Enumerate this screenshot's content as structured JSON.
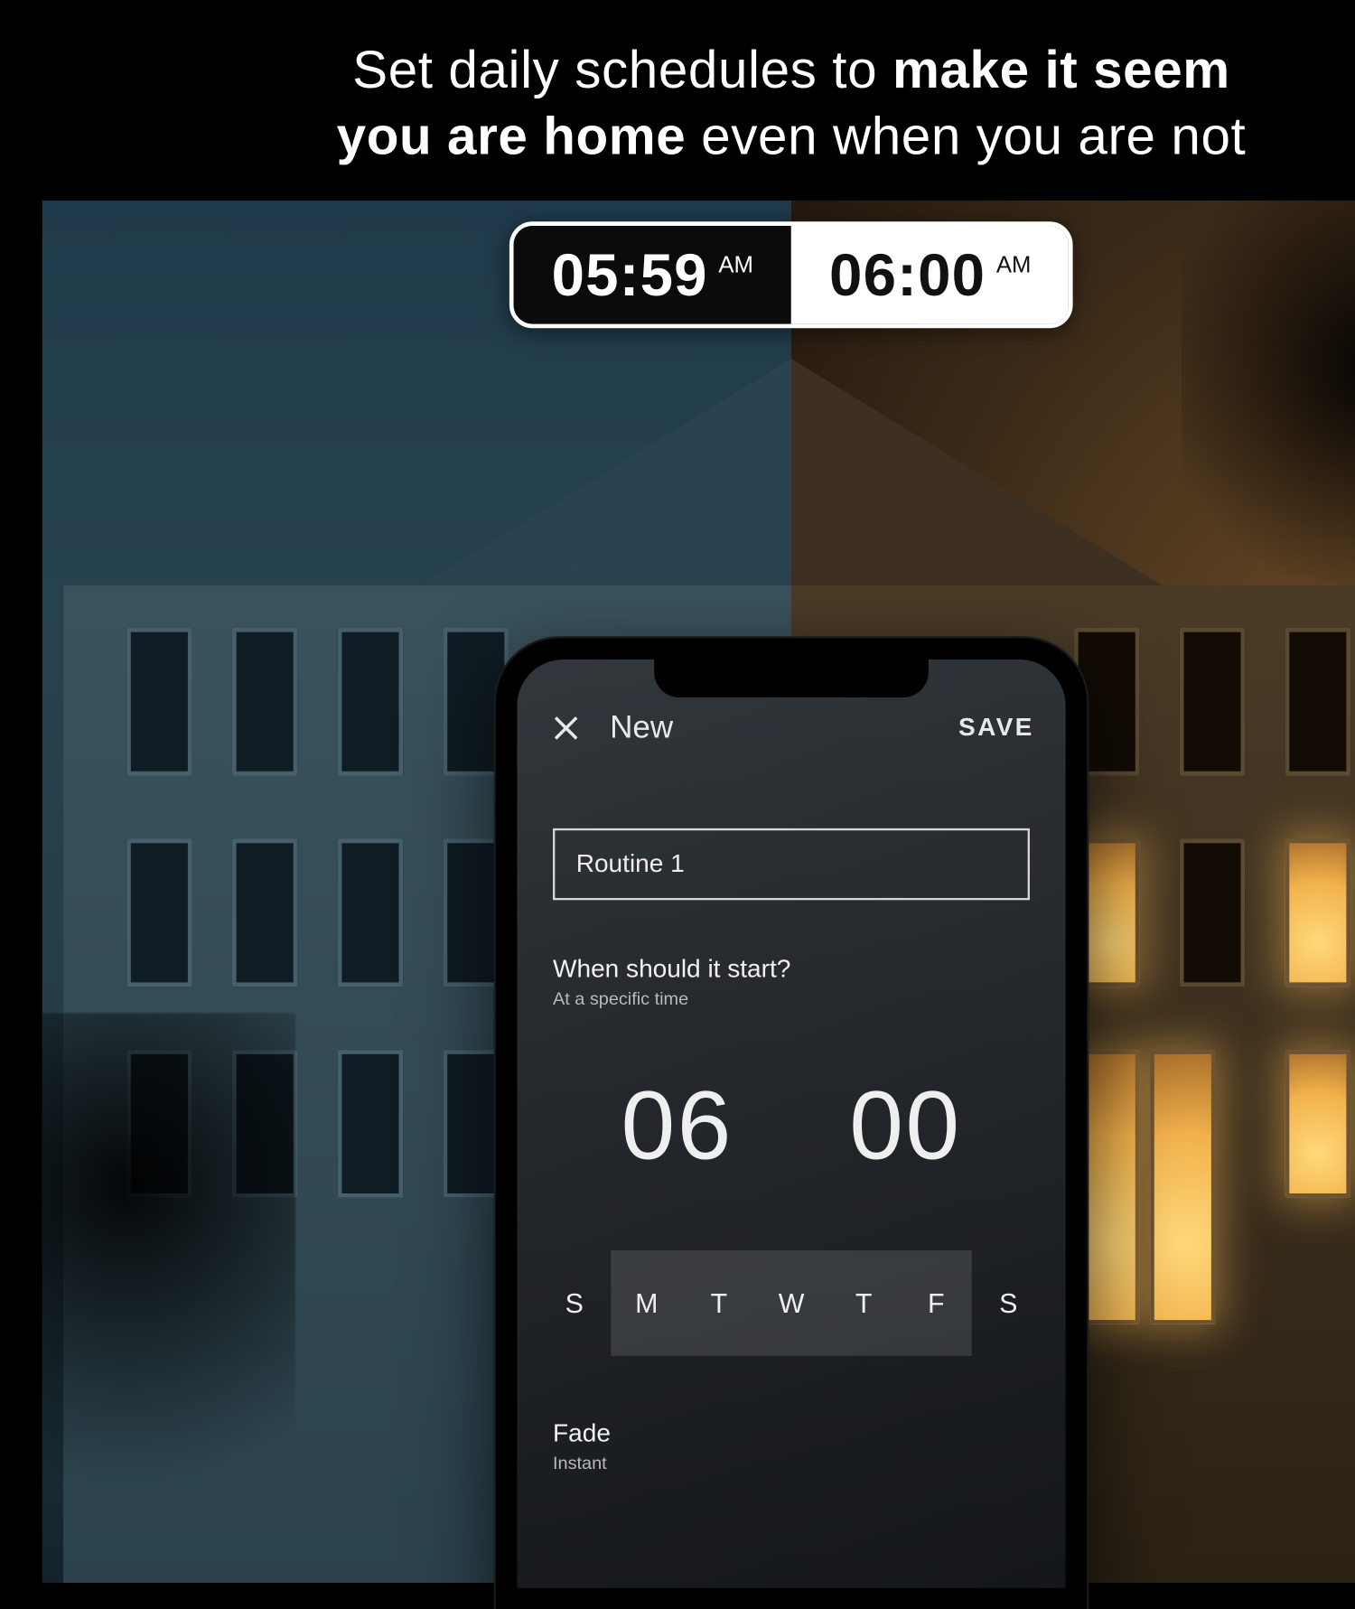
{
  "headline": {
    "pre": "Set daily schedules to ",
    "bold1": "make it seem",
    "br": true,
    "bold2": "you are home",
    "post": " even when you are not"
  },
  "timebadge": {
    "left_time": "05:59",
    "left_ampm": "AM",
    "right_time": "06:00",
    "right_ampm": "AM"
  },
  "app": {
    "title": "New",
    "save": "SAVE",
    "routine_name": "Routine 1",
    "question": "When should it start?",
    "question_sub": "At a specific time",
    "hour": "06",
    "minute": "00",
    "days": [
      "S",
      "M",
      "T",
      "W",
      "T",
      "F",
      "S"
    ],
    "days_selected": [
      false,
      true,
      true,
      true,
      true,
      true,
      false
    ],
    "fade_label": "Fade",
    "fade_value": "Instant"
  }
}
